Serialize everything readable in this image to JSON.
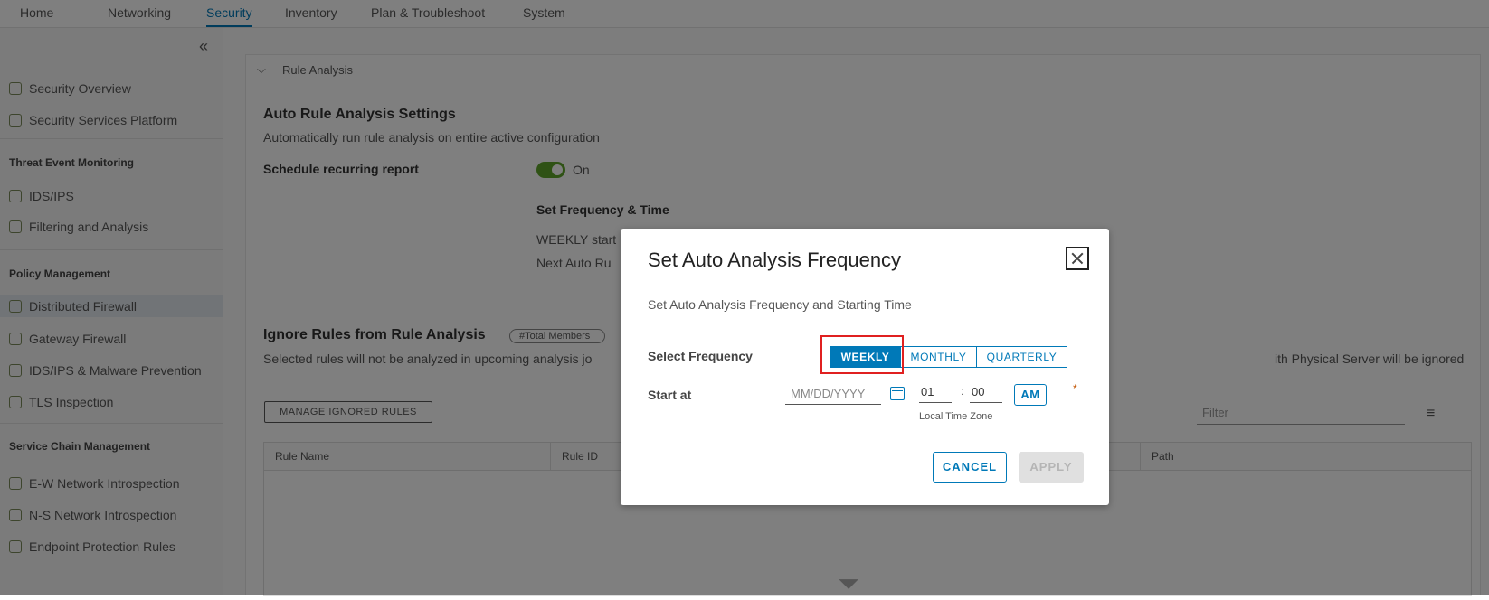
{
  "topnav": {
    "tabs": [
      {
        "label": "Home"
      },
      {
        "label": "Networking"
      },
      {
        "label": "Security"
      },
      {
        "label": "Inventory"
      },
      {
        "label": "Plan & Troubleshoot"
      },
      {
        "label": "System"
      }
    ],
    "active": "Security"
  },
  "sidebar": {
    "items": [
      {
        "label": "Security Overview"
      },
      {
        "label": "Security Services Platform"
      },
      {
        "label": "IDS/IPS"
      },
      {
        "label": "Filtering and Analysis"
      },
      {
        "label": "Distributed Firewall"
      },
      {
        "label": "Gateway Firewall"
      },
      {
        "label": "IDS/IPS & Malware Prevention"
      },
      {
        "label": "TLS Inspection"
      },
      {
        "label": "E-W Network Introspection"
      },
      {
        "label": "N-S Network Introspection"
      },
      {
        "label": "Endpoint Protection Rules"
      }
    ],
    "headers": [
      "Threat Event Monitoring",
      "Policy Management",
      "Service Chain Management"
    ]
  },
  "main": {
    "section_title": "Rule Analysis",
    "auto_title": "Auto Rule Analysis Settings",
    "auto_desc": "Automatically run rule analysis on entire active configuration",
    "schedule_label": "Schedule recurring report",
    "toggle_state": "On",
    "freq_time_title": "Set Frequency & Time",
    "weekly_text": "WEEKLY start",
    "next_text": "Next Auto Ru",
    "ignore_title": "Ignore Rules from Rule Analysis",
    "total_badge": "#Total Members",
    "ignore_desc": "Selected rules will not be analyzed in upcoming analysis jo",
    "ignore_desc_right": "ith Physical Server will be ignored",
    "manage_button": "MANAGE IGNORED RULES",
    "filter_placeholder": "Filter",
    "columns": [
      "Rule Name",
      "Rule ID",
      "Path"
    ]
  },
  "modal": {
    "title": "Set Auto Analysis Frequency",
    "subtitle": "Set Auto Analysis Frequency and Starting Time",
    "frequency_label": "Select Frequency",
    "frequency_options": [
      "WEEKLY",
      "MONTHLY",
      "QUARTERLY"
    ],
    "selected_frequency": "WEEKLY",
    "start_label": "Start at",
    "date_placeholder": "MM/DD/YYYY",
    "hour": "01",
    "time_separator": ":",
    "minute": "00",
    "ampm": "AM",
    "required_mark": "*",
    "timezone_label": "Local Time Zone",
    "cancel_button": "CANCEL",
    "apply_button": "APPLY"
  },
  "colors": {
    "accent": "#0079b8",
    "toggle_on": "#5ea52b",
    "highlight": "#e02020",
    "required": "#c25400"
  }
}
